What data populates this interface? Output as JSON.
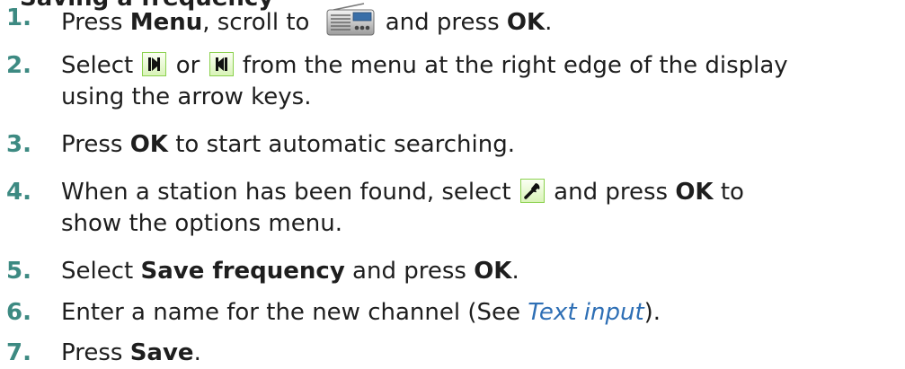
{
  "heading_partial": "Saving a frequency",
  "steps": [
    {
      "num": "1.",
      "parts": [
        "Press ",
        "Menu",
        ", scroll to",
        "and press ",
        "OK",
        "."
      ]
    },
    {
      "num": "2.",
      "parts": [
        "Select ",
        "or",
        "from the menu at the right edge of the display",
        "using the arrow keys."
      ]
    },
    {
      "num": "3.",
      "parts": [
        "Press ",
        "OK",
        " to start automatic searching."
      ]
    },
    {
      "num": "4.",
      "parts": [
        "When a station has been found, select",
        "and press ",
        "OK",
        " to",
        "show the options menu."
      ]
    },
    {
      "num": "5.",
      "parts": [
        "Select ",
        "Save frequency",
        " and press ",
        "OK",
        "."
      ]
    },
    {
      "num": "6.",
      "parts": [
        "Enter a name for the new channel (See ",
        "Text input",
        ")."
      ]
    },
    {
      "num": "7.",
      "parts": [
        "Press ",
        "Save",
        "."
      ]
    }
  ],
  "icons": {
    "radio": "radio-icon",
    "seek_forward": "seek-forward-icon",
    "seek_back": "seek-back-icon",
    "options": "wrench-icon"
  },
  "colors": {
    "step_number": "#3d8a82",
    "link": "#2e6fb5",
    "icon_border": "#8bd14e"
  }
}
